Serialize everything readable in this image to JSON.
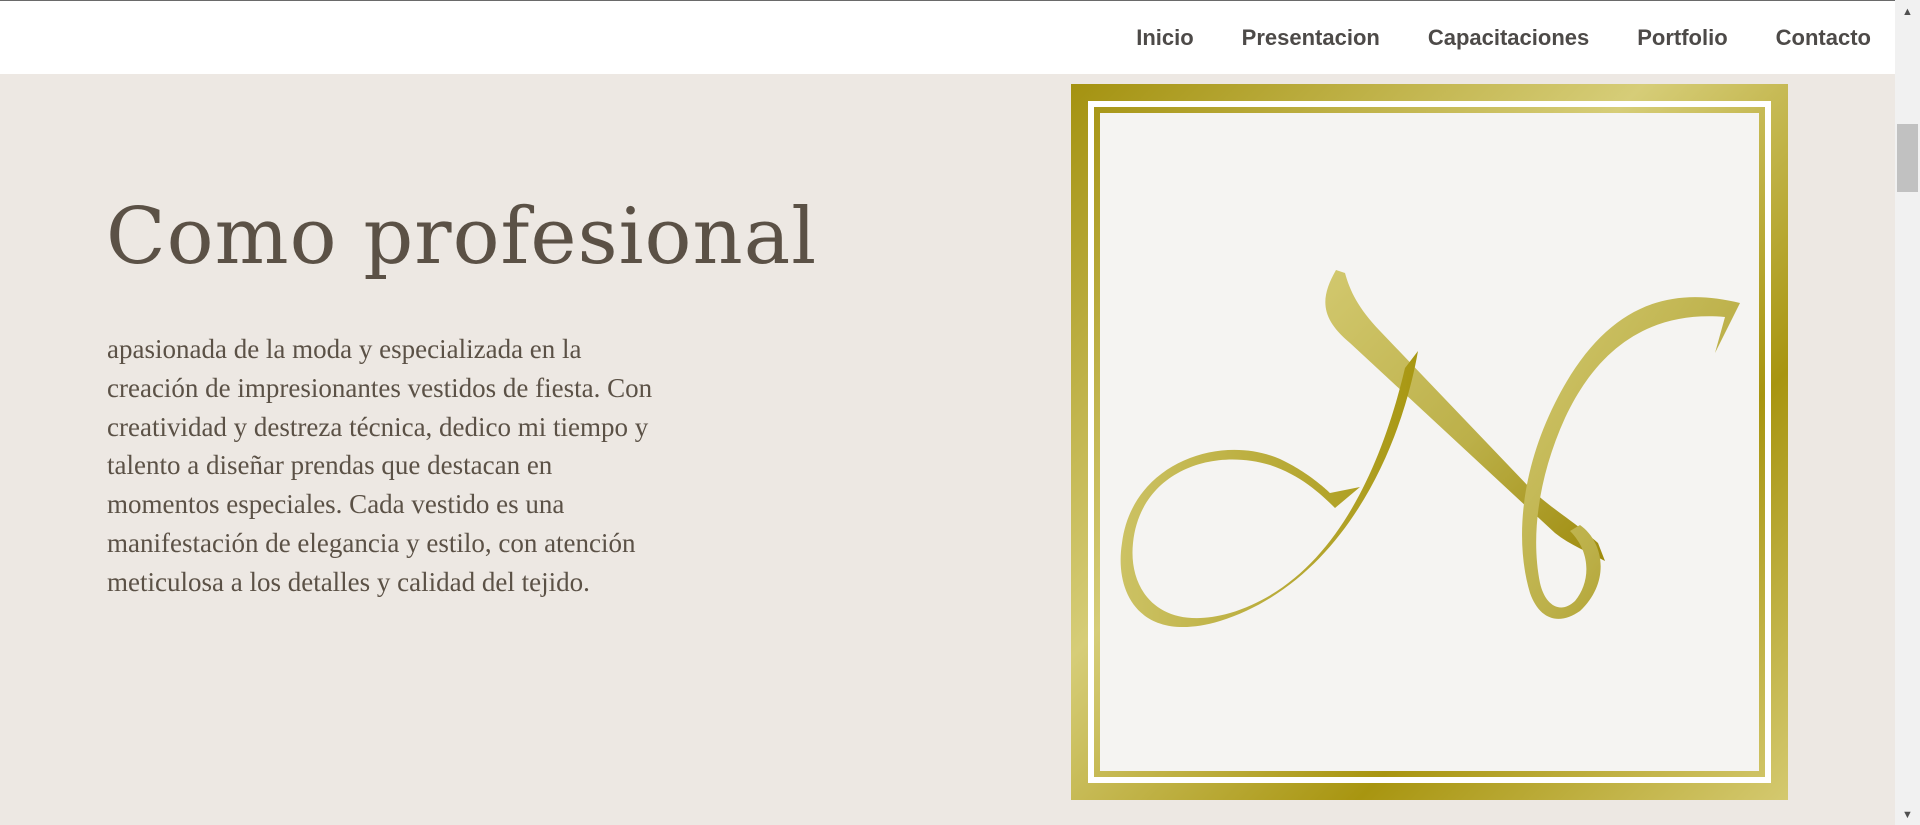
{
  "nav": {
    "items": [
      {
        "label": "Inicio"
      },
      {
        "label": "Presentacion"
      },
      {
        "label": "Capacitaciones"
      },
      {
        "label": "Portfolio"
      },
      {
        "label": "Contacto"
      }
    ]
  },
  "hero": {
    "title": "Como profesional",
    "body": "apasionada de la moda y especializada en la creación de impresionantes vestidos de fiesta. Con creatividad y destreza técnica, dedico mi tiempo y talento a diseñar prendas que destacan en momentos especiales. Cada vestido es una manifestación de elegancia y estilo, con atención meticulosa a los detalles y calidad del tejido."
  },
  "logo": {
    "icon": "monogram-logo",
    "colors": {
      "gold_dark": "#a49210",
      "gold_light": "#d6cd78",
      "background": "#f5f4f2"
    }
  },
  "colors": {
    "page_background": "#ede8e3",
    "text": "#5b5146",
    "nav_text": "#4d4a48",
    "navbar_background": "#ffffff"
  }
}
